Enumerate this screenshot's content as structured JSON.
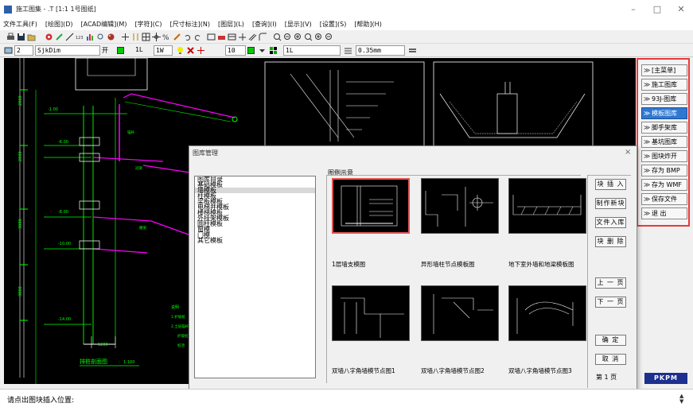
{
  "window": {
    "title": "施工图集 - .T [1:1  1号图纸]",
    "minimize": "–",
    "maximize": "□",
    "close": "✕"
  },
  "menu": [
    "文件工具(F)",
    "[绘图](D)",
    "[ACAD编辑](M)",
    "[字符](C)",
    "[尺寸标注](N)",
    "[图层](L)",
    "[查询](I)",
    "[显示](V)",
    "[设置](S)",
    "[帮助](H)"
  ],
  "toolbar2": {
    "layer_number": "2",
    "layer_name": "SjkDim",
    "state": "开",
    "lineweight_1": "1L",
    "lineweight_2": "1W",
    "text_height": "10",
    "linetype": "1L",
    "line_width": "0.35mm"
  },
  "side_panel": {
    "items": [
      {
        "label": "[主菜单]",
        "active": false
      },
      {
        "label": "施工图库",
        "active": false
      },
      {
        "label": "93J-图库",
        "active": false
      },
      {
        "label": "模板图库",
        "active": true
      },
      {
        "label": "脚手架库",
        "active": false
      },
      {
        "label": "基坑图库",
        "active": false
      },
      {
        "label": "图块炸开",
        "active": false
      },
      {
        "label": "存为 BMP",
        "active": false
      },
      {
        "label": "存为 WMF",
        "active": false
      },
      {
        "label": "保存文件",
        "active": false
      },
      {
        "label": "退    出",
        "active": false
      }
    ],
    "logo_text": "PKPM"
  },
  "drawing": {
    "elevations": [
      "-1.00",
      "-6.00",
      "-8.00",
      "-10.00",
      "-14.00"
    ],
    "heights": [
      "2000",
      "2000",
      "3000",
      "3000"
    ],
    "bottom_dim": "1200",
    "title": "排桩剖面图",
    "scale": "1:100",
    "notes_title": "说明",
    "notes": [
      "1.护坡桩",
      "2.土层锚杆",
      "护坡桩",
      "桩顶"
    ],
    "anchor_labels": [
      "锚杆",
      "冠梁",
      "腰梁"
    ]
  },
  "dialog": {
    "title": "图库管理",
    "close": "×",
    "tree_label": "图库目录",
    "tree_items": [
      "图库目录",
      "基础模板",
      "墙模板",
      "柱模板",
      "梁板模板",
      "电梯井模板",
      "楼梯模板",
      "外挂架模板",
      "圆柱模板",
      "窗模",
      "门模",
      "其它模板"
    ],
    "selected_tree_index": 2,
    "preview_label": "图例示意",
    "thumbnails": [
      {
        "caption": "1层墙支模图",
        "selected": true
      },
      {
        "caption": "异形墙柱节点模板图",
        "selected": false
      },
      {
        "caption": "地下室外墙和地梁模板图",
        "selected": false
      },
      {
        "caption": "双墙八字角墙模节点图1",
        "selected": false
      },
      {
        "caption": "双墙八字角墙模节点图2",
        "selected": false
      },
      {
        "caption": "双墙八字角墙模节点图3",
        "selected": false
      }
    ],
    "buttons": {
      "insert": "块 插 入",
      "make": "制作新块",
      "save_to_lib": "文件入库",
      "delete": "块 删 除",
      "prev_page": "上 一 页",
      "next_page": "下 一 页",
      "ok": "确  定",
      "cancel": "取  消"
    },
    "page_indicator": "第 1 页"
  },
  "command": {
    "prompt": "请点出图块插入位置:"
  },
  "colors": {
    "accent_border": "#e83a3a",
    "active_blue": "#2e78d2",
    "cad_green": "#00ff00",
    "cad_magenta": "#ff00ff",
    "cad_white": "#ffffff"
  }
}
